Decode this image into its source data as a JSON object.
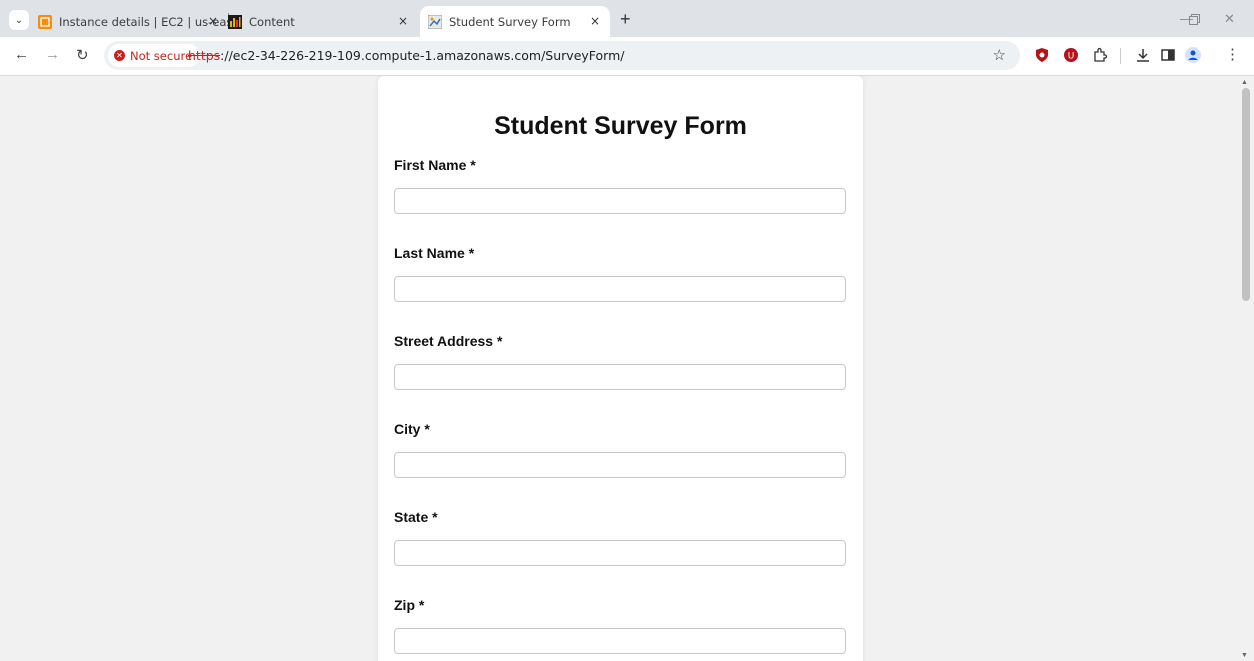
{
  "browser": {
    "tabs": [
      {
        "title": "Instance details | EC2 | us-east-",
        "active": false
      },
      {
        "title": "Content",
        "active": false
      },
      {
        "title": "Student Survey Form",
        "active": true
      }
    ],
    "close_glyph": "×",
    "new_tab_glyph": "+",
    "security_label": "Not secure",
    "url_scheme": "https",
    "url_rest": "://ec2-34-226-219-109.compute-1.amazonaws.com/SurveyForm/"
  },
  "form": {
    "title": "Student Survey Form",
    "fields": [
      {
        "label": "First Name *",
        "value": ""
      },
      {
        "label": "Last Name *",
        "value": ""
      },
      {
        "label": "Street Address *",
        "value": ""
      },
      {
        "label": "City *",
        "value": ""
      },
      {
        "label": "State *",
        "value": ""
      },
      {
        "label": "Zip *",
        "value": ""
      }
    ]
  },
  "colors": {
    "accent_warning": "#c5221f",
    "tab_favicon_ec2": "#f68d11"
  },
  "icons": [
    "tab-list-icon",
    "back-icon",
    "forward-icon",
    "reload-icon",
    "warning-icon",
    "star-icon",
    "shield-extension-icon",
    "ublock-icon",
    "extensions-icon",
    "download-icon",
    "side-panel-icon",
    "profile-icon",
    "menu-icon",
    "minimize-icon",
    "restore-icon",
    "close-window-icon"
  ]
}
